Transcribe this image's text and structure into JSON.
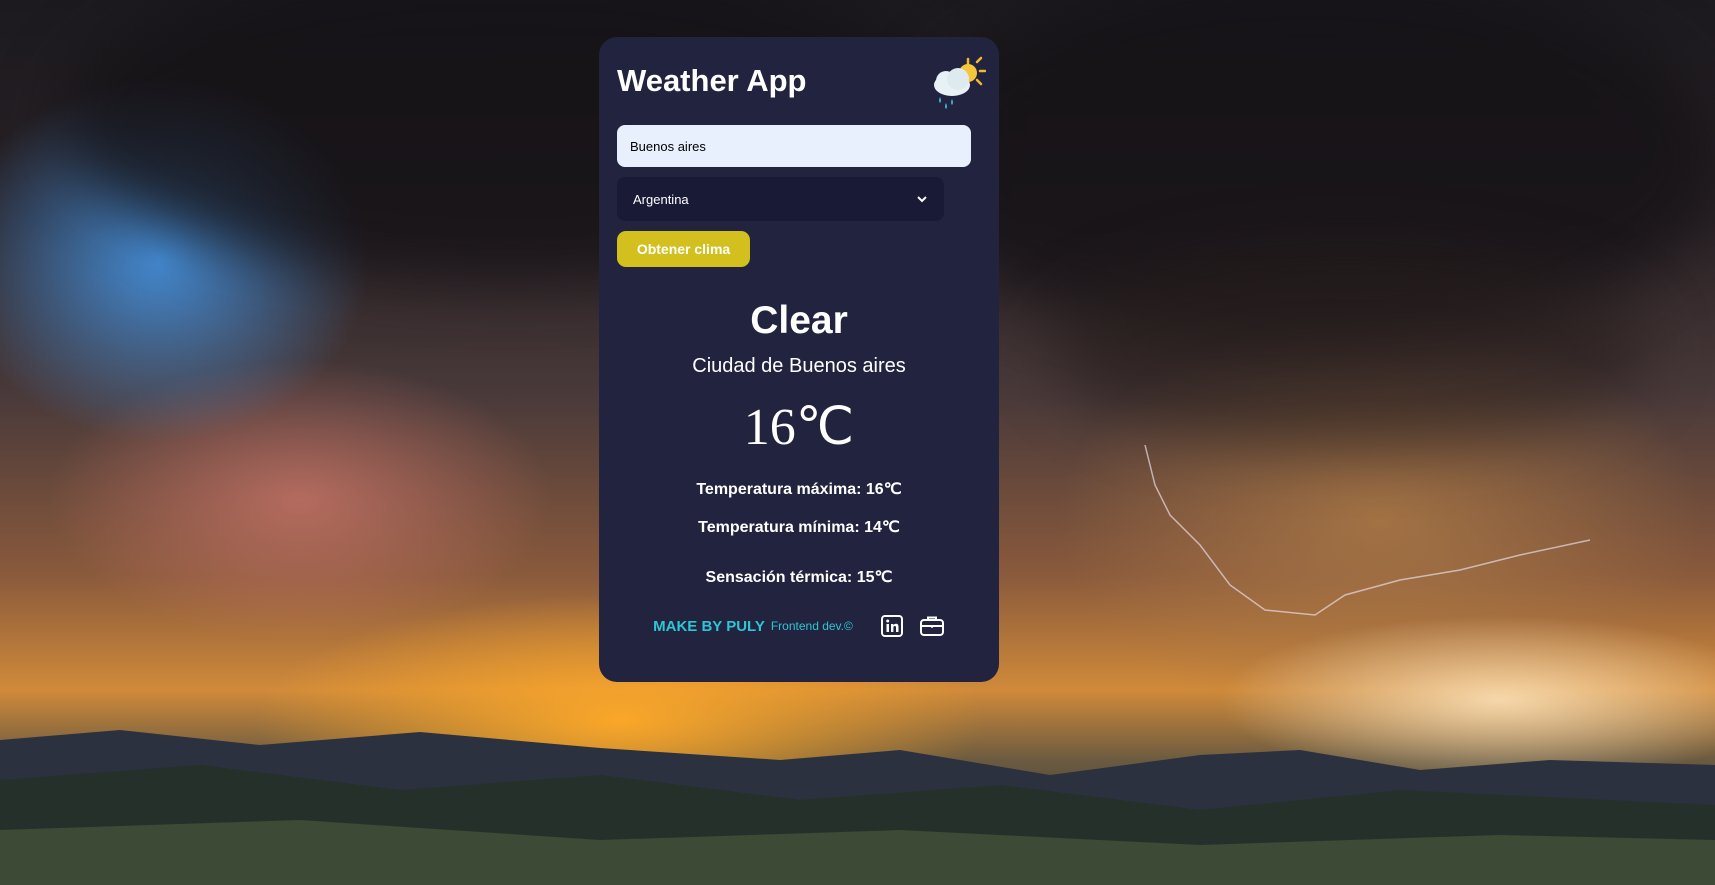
{
  "app": {
    "title": "Weather App",
    "logo_icon": "weather-logo-icon"
  },
  "form": {
    "city_value": "Buenos aires",
    "country_selected": "Argentina",
    "submit_label": "Obtener clima"
  },
  "result": {
    "condition": "Clear",
    "city": "Ciudad de Buenos aires",
    "temperature": "16℃",
    "max_temp": "Temperatura máxima: 16℃",
    "min_temp": "Temperatura mínima: 14℃",
    "feels_like": "Sensación térmica: 15℃"
  },
  "footer": {
    "brand": "MAKE BY PULY",
    "subtitle": "Frontend dev.©",
    "icons": [
      "linkedin-icon",
      "briefcase-icon"
    ]
  },
  "colors": {
    "card_bg": "#22243f",
    "input_bg": "#e8f0fe",
    "select_bg": "#181a36",
    "button_bg": "#d3c01f",
    "accent": "#2ec5d6"
  }
}
